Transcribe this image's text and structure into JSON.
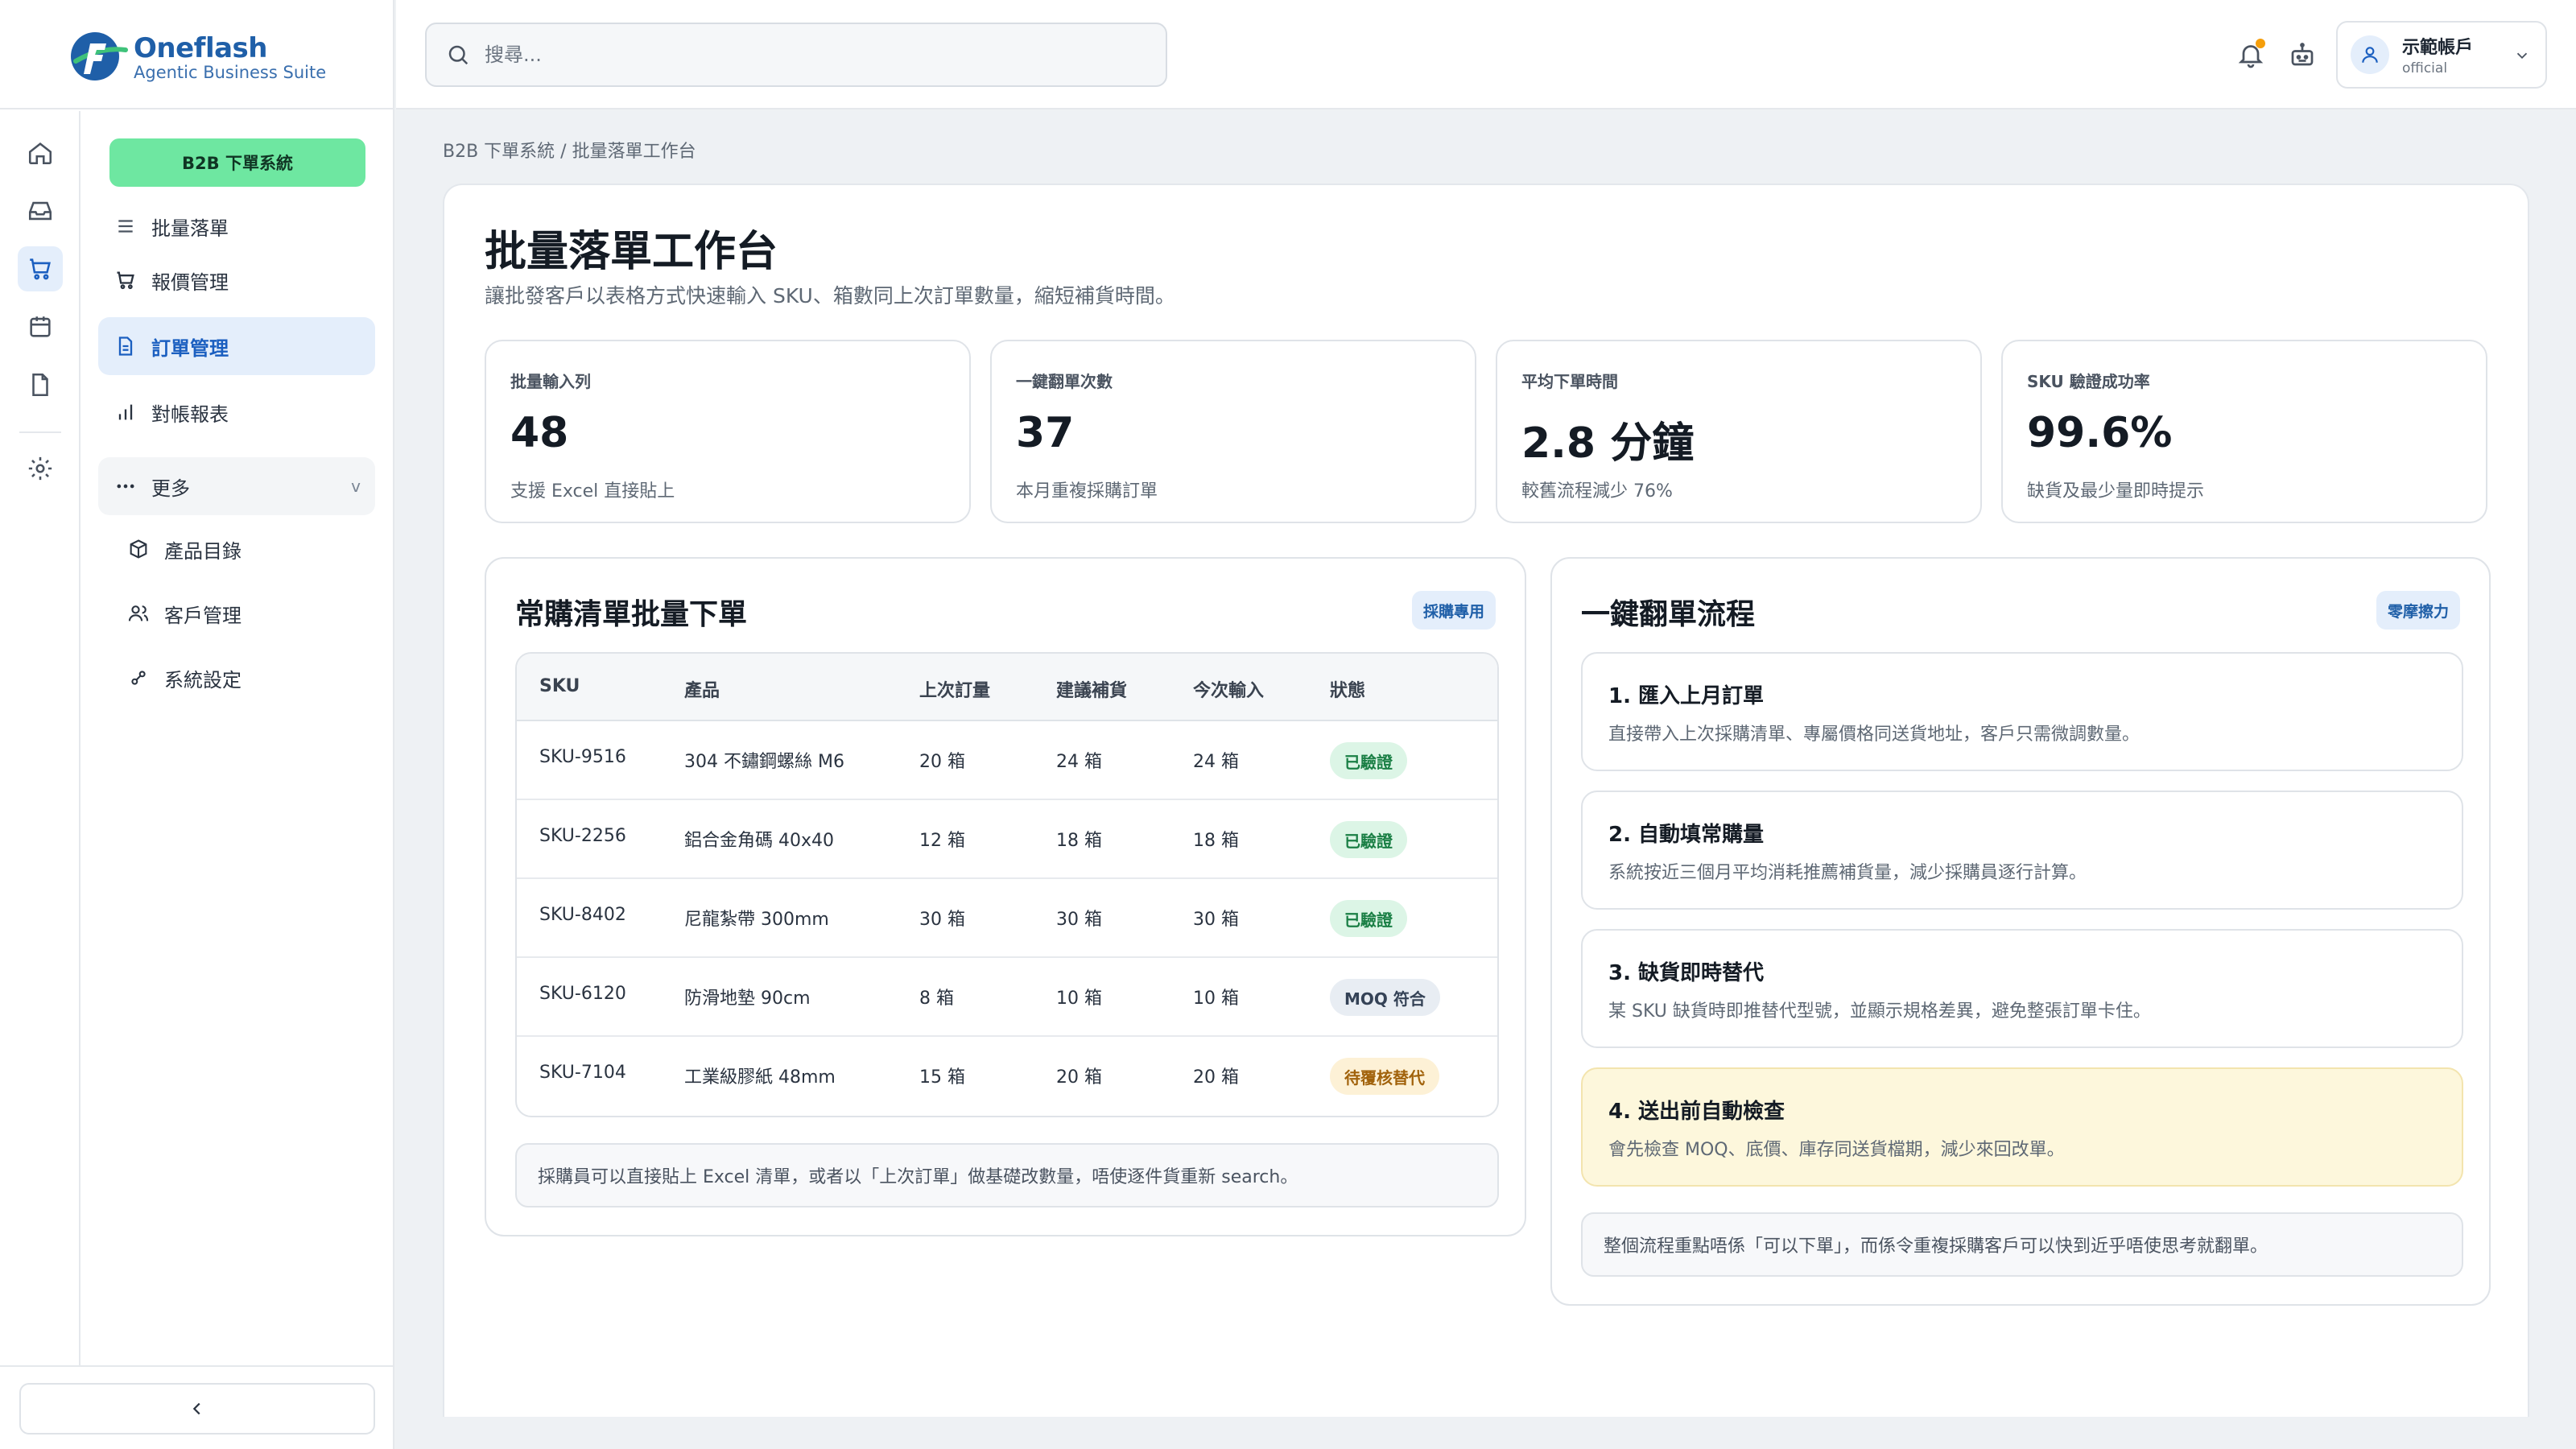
{
  "brand": {
    "name": "Oneflash",
    "tagline": "Agentic Business Suite"
  },
  "rail_icons": [
    "home-icon",
    "inbox-icon",
    "cart-icon",
    "calendar-icon",
    "file-icon",
    "settings-icon"
  ],
  "nav": {
    "module_chip": "B2B 下單系統",
    "menu_header": "批量落單",
    "items": [
      {
        "label": "報價管理",
        "icon": "cart-icon"
      },
      {
        "label": "訂單管理",
        "icon": "document-icon",
        "active": true
      },
      {
        "label": "對帳報表",
        "icon": "bar-chart-icon"
      }
    ],
    "more_label": "更多",
    "more_chevron": "v",
    "sub_items": [
      {
        "label": "產品目錄",
        "icon": "box-icon"
      },
      {
        "label": "客戶管理",
        "icon": "users-icon"
      },
      {
        "label": "系統設定",
        "icon": "sliders-icon"
      }
    ],
    "collapse_glyph": "‹"
  },
  "topbar": {
    "search_placeholder": "搜尋...",
    "account_name": "示範帳戶",
    "account_sub": "official"
  },
  "breadcrumb": "B2B 下單系統 / 批量落單工作台",
  "page": {
    "title": "批量落單工作台",
    "subtitle": "讓批發客戶以表格方式快速輸入 SKU、箱數同上次訂單數量，縮短補貨時間。"
  },
  "stats": [
    {
      "label": "批量輸入列",
      "value": "48",
      "note": "支援 Excel 直接貼上"
    },
    {
      "label": "一鍵翻單次數",
      "value": "37",
      "note": "本月重複採購訂單"
    },
    {
      "label": "平均下單時間",
      "value": "2.8 分鐘",
      "note": "較舊流程減少 76%"
    },
    {
      "label": "SKU 驗證成功率",
      "value": "99.6%",
      "note": "缺貨及最少量即時提示"
    }
  ],
  "bulk_card": {
    "title": "常購清單批量下單",
    "tag": "採購專用",
    "columns": [
      "SKU",
      "產品",
      "上次訂量",
      "建議補貨",
      "今次輸入",
      "狀態"
    ],
    "rows": [
      {
        "sku": "SKU-9516",
        "product": "304 不鏽鋼螺絲 M6",
        "last": "20 箱",
        "suggest": "24 箱",
        "input": "24 箱",
        "status": "已驗證",
        "status_type": "ok"
      },
      {
        "sku": "SKU-2256",
        "product": "鋁合金角碼 40x40",
        "last": "12 箱",
        "suggest": "18 箱",
        "input": "18 箱",
        "status": "已驗證",
        "status_type": "ok"
      },
      {
        "sku": "SKU-8402",
        "product": "尼龍紮帶 300mm",
        "last": "30 箱",
        "suggest": "30 箱",
        "input": "30 箱",
        "status": "已驗證",
        "status_type": "ok"
      },
      {
        "sku": "SKU-6120",
        "product": "防滑地墊 90cm",
        "last": "8 箱",
        "suggest": "10 箱",
        "input": "10 箱",
        "status": "MOQ 符合",
        "status_type": "moq"
      },
      {
        "sku": "SKU-7104",
        "product": "工業級膠紙 48mm",
        "last": "15 箱",
        "suggest": "20 箱",
        "input": "20 箱",
        "status": "待覆核替代",
        "status_type": "wait"
      }
    ],
    "note": "採購員可以直接貼上 Excel 清單，或者以「上次訂單」做基礎改數量，唔使逐件貨重新 search。"
  },
  "flow_card": {
    "title": "一鍵翻單流程",
    "tag": "零摩擦力",
    "steps": [
      {
        "title": "1. 匯入上月訂單",
        "desc": "直接帶入上次採購清單、專屬價格同送貨地址，客戶只需微調數量。"
      },
      {
        "title": "2. 自動填常購量",
        "desc": "系統按近三個月平均消耗推薦補貨量，減少採購員逐行計算。"
      },
      {
        "title": "3. 缺貨即時替代",
        "desc": "某 SKU 缺貨時即推替代型號，並顯示規格差異，避免整張訂單卡住。"
      },
      {
        "title": "4. 送出前自動檢查",
        "desc": "會先檢查 MOQ、底價、庫存同送貨檔期，減少來回改單。"
      }
    ],
    "note": "整個流程重點唔係「可以下單」，而係令重複採購客戶可以快到近乎唔使思考就翻單。"
  },
  "colors": {
    "accent": "#1b5fc0",
    "chip": "#6ee7a1",
    "ok": "#1a7f45",
    "warn": "#a1620b",
    "highlight": "#fdf7dc"
  }
}
